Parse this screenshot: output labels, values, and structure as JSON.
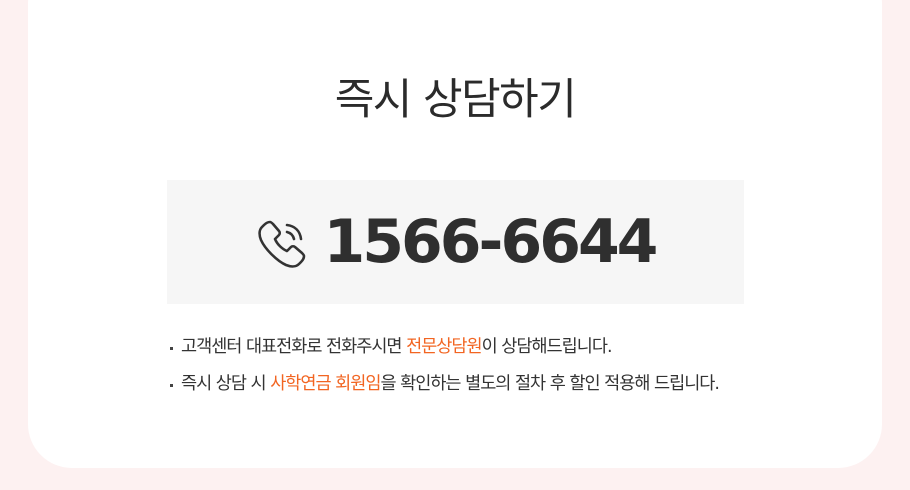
{
  "title": "즉시 상담하기",
  "phone": {
    "icon": "phone-icon",
    "number": "1566-6644"
  },
  "notes": [
    {
      "before": "고객센터 대표전화로 전화주시면 ",
      "highlight": "전문상담원",
      "after": "이 상담해드립니다."
    },
    {
      "before": "즉시 상담 시 ",
      "highlight": "사학연금 회원임",
      "after": "을  확인하는 별도의 절차 후 할인 적용해 드립니다."
    }
  ],
  "colors": {
    "accent": "#f26522",
    "page_background": "#fdf1f1",
    "card_background": "#ffffff",
    "phone_box_background": "#f6f6f6",
    "text": "#333333"
  }
}
